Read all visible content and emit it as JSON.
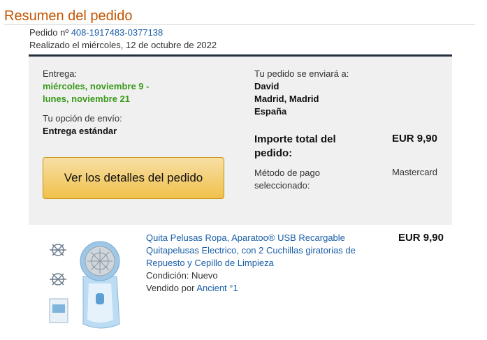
{
  "header": {
    "title": "Resumen del pedido",
    "order_label": "Pedido nº",
    "order_number": "408-1917483-0377138",
    "placed": "Realizado el miércoles, 12 de octubre de 2022"
  },
  "delivery": {
    "label": "Entrega:",
    "date_line1": "miércoles, noviembre 9 -",
    "date_line2": "lunes, noviembre 21",
    "option_label": "Tu opción de envío:",
    "option_value": "Entrega estándar"
  },
  "shipping": {
    "label": "Tu pedido se enviará a:",
    "name": "David",
    "city": "Madrid, Madrid",
    "country": "España"
  },
  "summary": {
    "total_label": "Importe total del pedido:",
    "total_value": "EUR 9,90",
    "payment_label": "Método de pago seleccionado:",
    "payment_value": "Mastercard"
  },
  "actions": {
    "details_button": "Ver los detalles del pedido"
  },
  "item": {
    "title": "Quita Pelusas Ropa, Aparatoo® USB Recargable Quitapelusas Electrico, con 2 Cuchillas giratorias de Repuesto y Cepillo de Limpieza",
    "price": "EUR 9,90",
    "condition": "Condición: Nuevo",
    "seller_label": "Vendido por",
    "seller_name": "Ancient °1"
  },
  "colors": {
    "title": "#c45500",
    "link": "#1a5fa8",
    "delivery_green": "#3a9a1a",
    "button": "#f0c14b",
    "panel": "#f0f0f0"
  }
}
